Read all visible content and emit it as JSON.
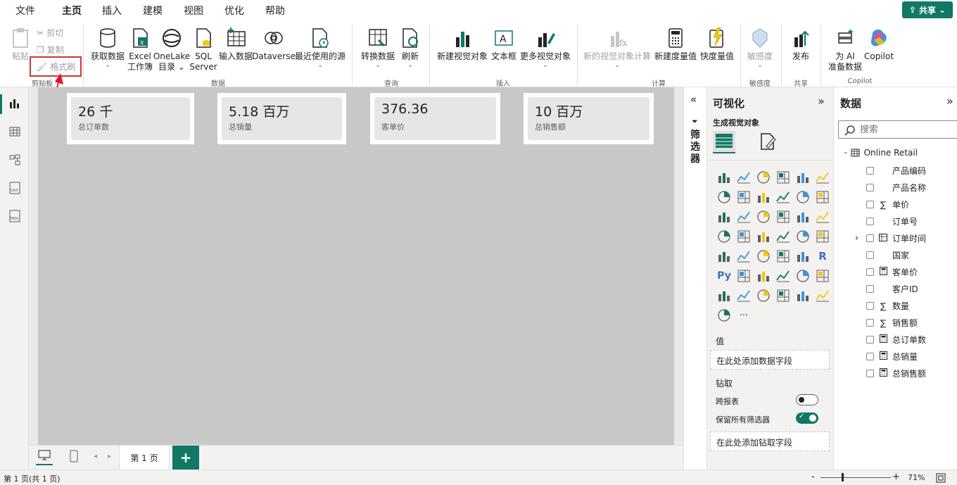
{
  "menu": {
    "items": [
      "文件",
      "主页",
      "插入",
      "建模",
      "视图",
      "优化",
      "帮助"
    ],
    "active_index": 1,
    "share": "共享"
  },
  "ribbon": {
    "clipboard": {
      "paste": "粘贴",
      "cut": "剪切",
      "copy": "复制",
      "format_painter": "格式刷",
      "group": "剪贴板"
    },
    "data": {
      "get_data": "获取数据",
      "excel": [
        "Excel",
        "工作簿"
      ],
      "onelake": [
        "OneLake",
        "目录"
      ],
      "sql": [
        "SQL",
        "Server"
      ],
      "enter_data": "输入数据",
      "dataverse": "Dataverse",
      "recent": "最近使用的源",
      "group": "数据"
    },
    "queries": {
      "transform": "转换数据",
      "refresh": "刷新",
      "group": "查询"
    },
    "insert": {
      "new_visual": "新建视觉对象",
      "textbox": "文本框",
      "more_visuals": "更多视觉对象",
      "group": "插入"
    },
    "calc": {
      "new_calc": "新的视觉对象计算",
      "new_measure": "新建度量值",
      "quick_measure": "快度量值",
      "group": "计算"
    },
    "sensitivity": {
      "label": "敏感度",
      "group": "敏感度"
    },
    "share": {
      "publish": "发布",
      "group": "共享"
    },
    "copilot": {
      "ai_prep": [
        "为 AI",
        "准备数据"
      ],
      "copilot": "Copilot",
      "group": "Copilot"
    }
  },
  "cards": [
    {
      "value": "26 千",
      "label": "总订单数"
    },
    {
      "value": "5.18 百万",
      "label": "总销量"
    },
    {
      "value": "376.36",
      "label": "客单价"
    },
    {
      "value": "10 百万",
      "label": "总销售额"
    }
  ],
  "filters": {
    "label": "筛选器"
  },
  "viz": {
    "title": "可视化",
    "build_label": "生成视觉对象",
    "values_label": "值",
    "values_drop": "在此处添加数据字段",
    "drill_label": "钻取",
    "cross_report": "跨报表",
    "keep_filters": "保留所有筛选器",
    "drill_drop": "在此处添加钻取字段",
    "more": "···"
  },
  "data_pane": {
    "title": "数据",
    "search_placeholder": "搜索",
    "table": "Online Retail",
    "fields": [
      {
        "name": "产品编码",
        "kind": "none"
      },
      {
        "name": "产品名称",
        "kind": "none"
      },
      {
        "name": "单价",
        "kind": "sum"
      },
      {
        "name": "订单号",
        "kind": "none"
      },
      {
        "name": "订单时间",
        "kind": "table",
        "expandable": true
      },
      {
        "name": "国家",
        "kind": "none"
      },
      {
        "name": "客单价",
        "kind": "measure"
      },
      {
        "name": "客户ID",
        "kind": "none"
      },
      {
        "name": "数量",
        "kind": "sum"
      },
      {
        "name": "销售额",
        "kind": "sum"
      },
      {
        "name": "总订单数",
        "kind": "measure"
      },
      {
        "name": "总销量",
        "kind": "measure"
      },
      {
        "name": "总销售额",
        "kind": "measure"
      }
    ]
  },
  "pages": {
    "tab": "第 1 页",
    "add": "+"
  },
  "status": {
    "page_info": "第 1 页(共 1 页)",
    "zoom": "71%",
    "zoom_minus": "-",
    "zoom_plus": "+"
  },
  "colors": {
    "accent": "#117865",
    "highlight": "#d13438"
  }
}
